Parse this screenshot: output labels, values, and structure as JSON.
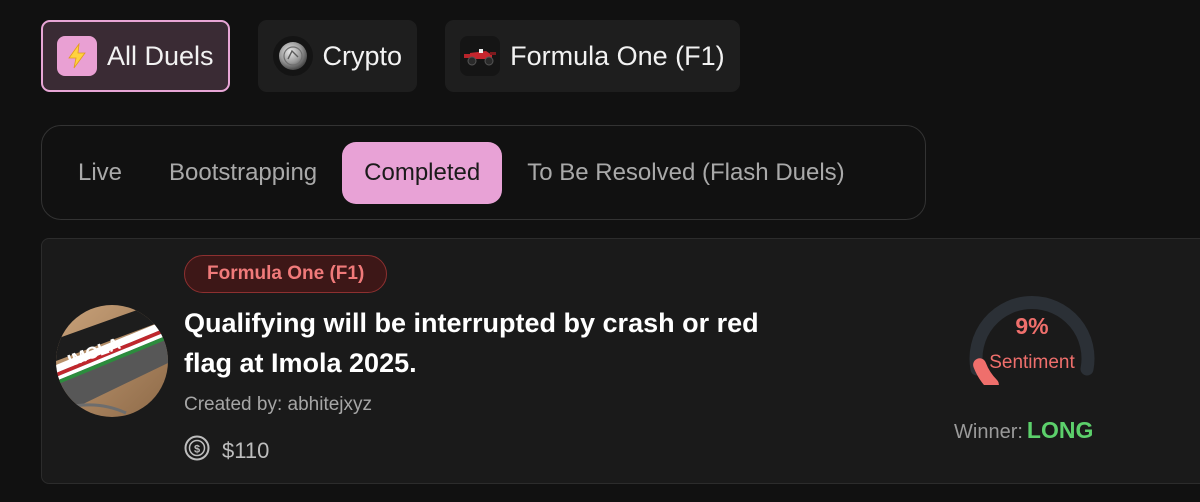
{
  "categories": [
    {
      "label": "All Duels",
      "icon": "lightning-bolt-icon",
      "active": true
    },
    {
      "label": "Crypto",
      "icon": "crypto-coin-icon",
      "active": false
    },
    {
      "label": "Formula One (F1)",
      "icon": "f1-car-icon",
      "active": false
    }
  ],
  "tabs": [
    {
      "label": "Live",
      "active": false
    },
    {
      "label": "Bootstrapping",
      "active": false
    },
    {
      "label": "Completed",
      "active": true
    },
    {
      "label": "To Be Resolved (Flash Duels)",
      "active": false
    }
  ],
  "duel": {
    "category": "Formula One (F1)",
    "title": "Qualifying will be interrupted by crash or red flag at Imola 2025.",
    "created_by_label": "Created by:",
    "creator": "abhitejxyz",
    "amount": "$110",
    "thumbnail_text": "IMOLA",
    "sentiment_value": 9,
    "sentiment_text": "9%",
    "sentiment_label": "Sentiment",
    "winner_label": "Winner:",
    "winner_value": "LONG"
  },
  "colors": {
    "accent_pink": "#e8a2d6",
    "sentiment_red": "#ef6f6c",
    "winner_green": "#5cd06b",
    "badge_red": "#f07a7a"
  }
}
